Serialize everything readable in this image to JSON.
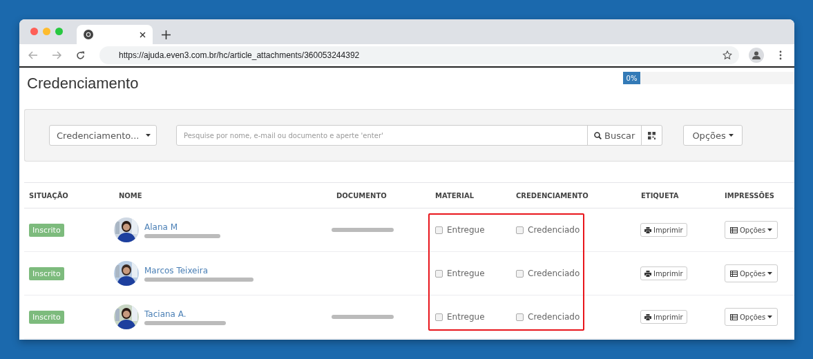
{
  "browser": {
    "address": "https://ajuda.even3.com.br/hc/article_attachments/360053244392"
  },
  "page": {
    "title": "Credenciamento",
    "progress": {
      "label": "0%",
      "level": 0
    }
  },
  "filters": {
    "select": "Credenciamento...",
    "search": {
      "placeholder": "Pesquise por nome, e-mail ou documento e aperte 'enter'"
    },
    "search_button": "Buscar",
    "options_button": "Opções"
  },
  "table": {
    "columns": [
      "SITUAÇÃO",
      "NOME",
      "DOCUMENTO",
      "MATERIAL",
      "CREDENCIAMENTO",
      "ETIQUETA",
      "IMPRESSÕES"
    ],
    "rows": [
      {
        "status": "Inscrito",
        "name": "Alana M",
        "document_shown": true,
        "material": {
          "label": "Entregue",
          "checked": false
        },
        "credential": {
          "label": "Credenciado",
          "checked": false
        },
        "label_button": "Imprimir",
        "print_button": "Opções"
      },
      {
        "status": "Inscrito",
        "name": "Marcos Teixeira",
        "document_shown": false,
        "material": {
          "label": "Entregue",
          "checked": false
        },
        "credential": {
          "label": "Credenciado",
          "checked": false
        },
        "label_button": "Imprimir",
        "print_button": "Opções"
      },
      {
        "status": "Inscrito",
        "name": "Taciana A.",
        "document_shown": true,
        "material": {
          "label": "Entregue",
          "checked": false
        },
        "credential": {
          "label": "Credenciado",
          "checked": false
        },
        "label_button": "Imprimir",
        "print_button": "Opções"
      }
    ]
  }
}
